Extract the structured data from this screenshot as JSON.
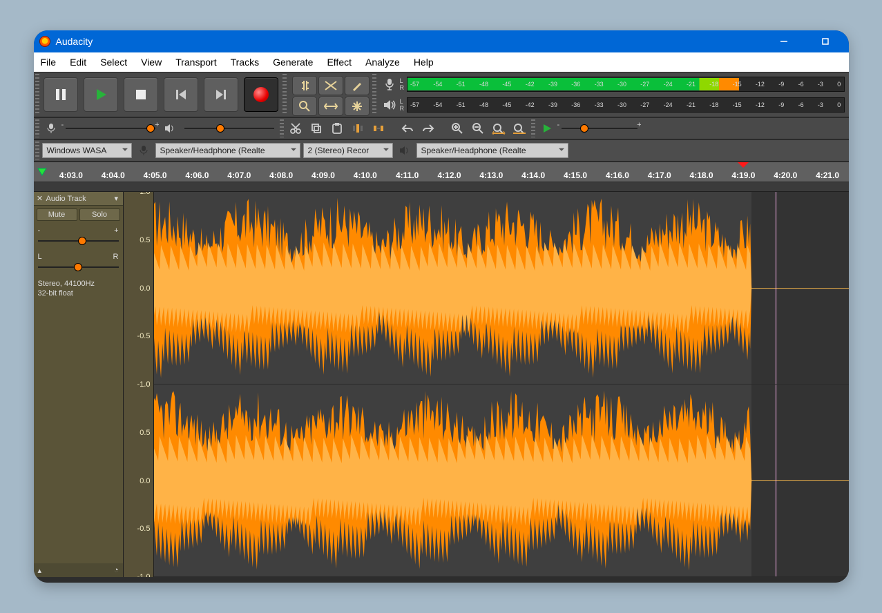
{
  "title": "Audacity",
  "menu": [
    "File",
    "Edit",
    "Select",
    "View",
    "Transport",
    "Tracks",
    "Generate",
    "Effect",
    "Analyze",
    "Help"
  ],
  "transport": {
    "pause": "Pause",
    "play": "Play",
    "stop": "Stop",
    "skip_start": "Skip to Start",
    "skip_end": "Skip to End",
    "record": "Record"
  },
  "tools": [
    "selection-tool",
    "envelope-tool",
    "draw-tool",
    "zoom-tool",
    "timeshift-tool",
    "multi-tool"
  ],
  "meter": {
    "L": "L",
    "R": "R",
    "ticks": [
      "-57",
      "-54",
      "-51",
      "-48",
      "-45",
      "-42",
      "-39",
      "-36",
      "-33",
      "-30",
      "-27",
      "-24",
      "-21",
      "-18",
      "-15",
      "-12",
      "-9",
      "-6",
      "-3",
      "0"
    ]
  },
  "tb2": {
    "mic_minus": "-",
    "mic_plus": "+",
    "rec_level_pct": 95,
    "spk_level_pct": 40,
    "play_level_pct": 30,
    "icons": [
      "cut",
      "copy",
      "paste",
      "trim",
      "silence",
      "undo",
      "redo",
      "zoom-in",
      "zoom-out",
      "fit-selection",
      "fit-project",
      "play-at-speed"
    ]
  },
  "devices": {
    "host": "Windows WASA",
    "rec_dev": "Speaker/Headphone (Realte",
    "channels": "2 (Stereo) Recor",
    "play_dev": "Speaker/Headphone (Realte"
  },
  "timeline": {
    "labels": [
      "4:03.0",
      "4:04.0",
      "4:05.0",
      "4:06.0",
      "4:07.0",
      "4:08.0",
      "4:09.0",
      "4:10.0",
      "4:11.0",
      "4:12.0",
      "4:13.0",
      "4:14.0",
      "4:15.0",
      "4:16.0",
      "4:17.0",
      "4:18.0",
      "4:19.0",
      "4:20.0",
      "4:21.0"
    ],
    "playhead_index": 16
  },
  "track": {
    "name": "Audio Track",
    "mute": "Mute",
    "solo": "Solo",
    "gain_pct": 55,
    "pan_pct": 50,
    "minus": "-",
    "plus": "+",
    "L": "L",
    "R": "R",
    "info1": "Stereo, 44100Hz",
    "info2": "32-bit float",
    "vscale": [
      "1.0",
      "0.5",
      "0.0",
      "-0.5",
      "-1.0"
    ],
    "cursor_pct": 89.5,
    "end_pct": 86
  }
}
